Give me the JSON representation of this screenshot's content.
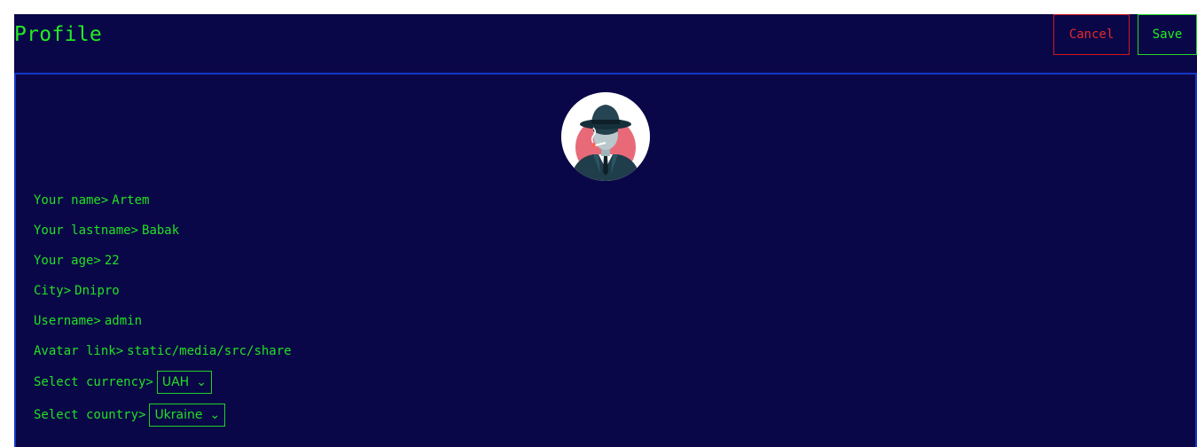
{
  "header": {
    "title": "Profile",
    "cancel_label": "Cancel",
    "save_label": "Save"
  },
  "fields": {
    "name": {
      "label": "Your name>",
      "value": "Artem"
    },
    "lastname": {
      "label": "Your lastname>",
      "value": "Babak"
    },
    "age": {
      "label": "Your age>",
      "value": "22"
    },
    "city": {
      "label": "City>",
      "value": "Dnipro"
    },
    "username": {
      "label": "Username>",
      "value": "admin"
    },
    "avatar_link": {
      "label": "Avatar link>",
      "value": "static/media/src/share"
    }
  },
  "currency": {
    "label": "Select currency>",
    "selected": "UAH"
  },
  "country": {
    "label": "Select country>",
    "selected": "Ukraine"
  },
  "colors": {
    "background": "#0a0748",
    "accent_green": "#22ee22",
    "cancel_red": "#e82828",
    "panel_border": "#1238c8"
  },
  "icons": {
    "avatar": "spy-avatar-icon",
    "dropdown": "chevron-down-icon"
  }
}
